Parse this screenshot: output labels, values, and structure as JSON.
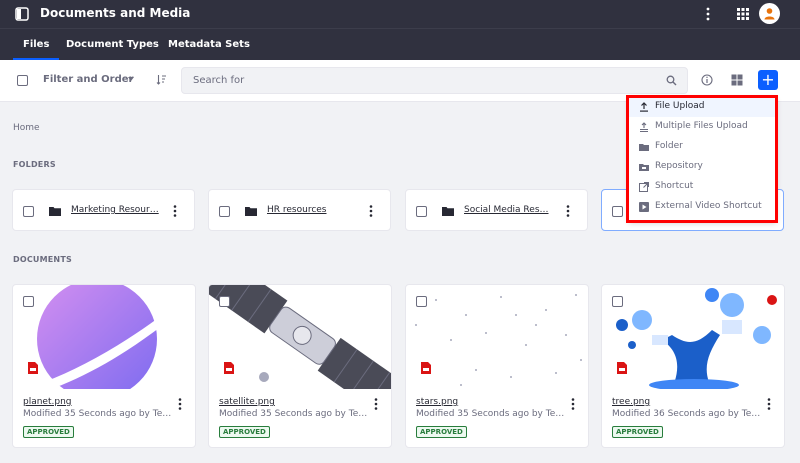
{
  "app": {
    "title": "Documents and Media"
  },
  "tabs": [
    {
      "label": "Files",
      "active": true
    },
    {
      "label": "Document Types",
      "active": false
    },
    {
      "label": "Metadata Sets",
      "active": false
    }
  ],
  "toolbar": {
    "filter_label": "Filter and Order",
    "search_placeholder": "Search for",
    "add_label": "+"
  },
  "breadcrumb": {
    "home": "Home"
  },
  "sections": {
    "folders": "FOLDERS",
    "documents": "DOCUMENTS"
  },
  "folders": [
    {
      "name": "Marketing Resour…"
    },
    {
      "name": "HR resources"
    },
    {
      "name": "Social Media Res…"
    }
  ],
  "documents": [
    {
      "name": "planet.png",
      "meta": "Modified 35 Seconds ago by Te…",
      "status": "APPROVED"
    },
    {
      "name": "satellite.png",
      "meta": "Modified 35 Seconds ago by Te…",
      "status": "APPROVED"
    },
    {
      "name": "stars.png",
      "meta": "Modified 35 Seconds ago by Te…",
      "status": "APPROVED"
    },
    {
      "name": "tree.png",
      "meta": "Modified 36 Seconds ago by Te…",
      "status": "APPROVED"
    }
  ],
  "add_menu": {
    "items": [
      {
        "label": "File Upload",
        "icon": "upload-icon"
      },
      {
        "label": "Multiple Files Upload",
        "icon": "multiple-upload-icon"
      },
      {
        "label": "Folder",
        "icon": "folder-icon"
      },
      {
        "label": "Repository",
        "icon": "repository-icon"
      },
      {
        "label": "Shortcut",
        "icon": "shortcut-icon"
      },
      {
        "label": "External Video Shortcut",
        "icon": "video-icon"
      }
    ]
  },
  "colors": {
    "header_bg": "#30313f",
    "accent": "#0b5fff",
    "approved": "#287d3c",
    "highlight": "#ff0000"
  }
}
